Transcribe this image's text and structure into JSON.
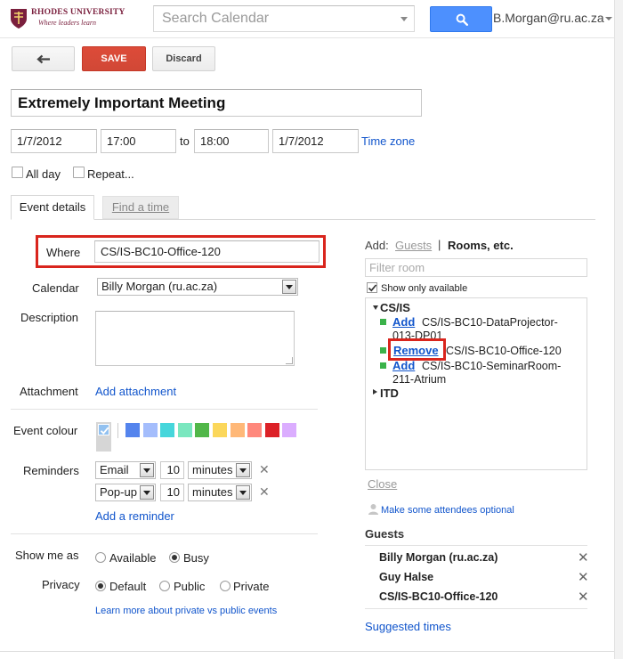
{
  "header": {
    "logo_name": "RHODES UNIVERSITY",
    "logo_tagline": "Where leaders learn",
    "search_placeholder": "Search Calendar",
    "user_email": "B.Morgan@ru.ac.za"
  },
  "toolbar": {
    "back_icon": "arrow-left-icon",
    "save_label": "SAVE",
    "discard_label": "Discard"
  },
  "event": {
    "title": "Extremely Important Meeting",
    "start_date": "1/7/2012",
    "start_time": "17:00",
    "to_label": "to",
    "end_time": "18:00",
    "end_date": "1/7/2012",
    "timezone_label": "Time zone",
    "allday_label": "All day",
    "repeat_label": "Repeat...",
    "allday_checked": false,
    "repeat_checked": false
  },
  "tabs": [
    {
      "label": "Event details",
      "active": true
    },
    {
      "label": "Find a time",
      "active": false
    }
  ],
  "details": {
    "where_label": "Where",
    "where_value": "CS/IS-BC10-Office-120",
    "calendar_label": "Calendar",
    "calendar_value": "Billy Morgan (ru.ac.za)",
    "description_label": "Description",
    "description_value": "",
    "attachment_label": "Attachment",
    "attachment_link": "Add attachment",
    "colour_label": "Event colour",
    "colour_selected": "#92c1f0",
    "colours": [
      "#5484ed",
      "#a4bdfc",
      "#46d6db",
      "#7ae7bf",
      "#51b749",
      "#fbd75b",
      "#ffb878",
      "#ff887c",
      "#dc2127",
      "#dbadff"
    ],
    "reminders_label": "Reminders",
    "reminders": [
      {
        "method": "Email",
        "amount": "10",
        "unit": "minutes"
      },
      {
        "method": "Pop-up",
        "amount": "10",
        "unit": "minutes"
      }
    ],
    "add_reminder_link": "Add a reminder",
    "showme_label": "Show me as",
    "showme_options": [
      {
        "label": "Available",
        "selected": false
      },
      {
        "label": "Busy",
        "selected": true
      }
    ],
    "privacy_label": "Privacy",
    "privacy_options": [
      {
        "label": "Default",
        "selected": true
      },
      {
        "label": "Public",
        "selected": false
      },
      {
        "label": "Private",
        "selected": false
      }
    ],
    "learn_more_link": "Learn more about private vs public events"
  },
  "rooms_panel": {
    "add_label": "Add:",
    "guests_tab": "Guests",
    "separator": "|",
    "rooms_tab": "Rooms, etc.",
    "filter_placeholder": "Filter room",
    "show_available_label": "Show only available",
    "show_available_checked": true,
    "groups": [
      {
        "name": "CS/IS",
        "expanded": true,
        "rooms": [
          {
            "action": "Add",
            "line1": "CS/IS-BC10-DataProjector-",
            "line2": "013-DP01"
          },
          {
            "action": "Remove",
            "line1": "CS/IS-BC10-Office-120",
            "line2": ""
          },
          {
            "action": "Add",
            "line1": "CS/IS-BC10-SeminarRoom-",
            "line2": "211-Atrium"
          }
        ]
      },
      {
        "name": "ITD",
        "expanded": false,
        "rooms": []
      }
    ],
    "close_link": "Close",
    "optional_link": "Make some attendees optional"
  },
  "guests": {
    "heading": "Guests",
    "list": [
      "Billy Morgan (ru.ac.za)",
      "Guy Halse",
      "CS/IS-BC10-Office-120"
    ],
    "suggested_link": "Suggested times"
  }
}
